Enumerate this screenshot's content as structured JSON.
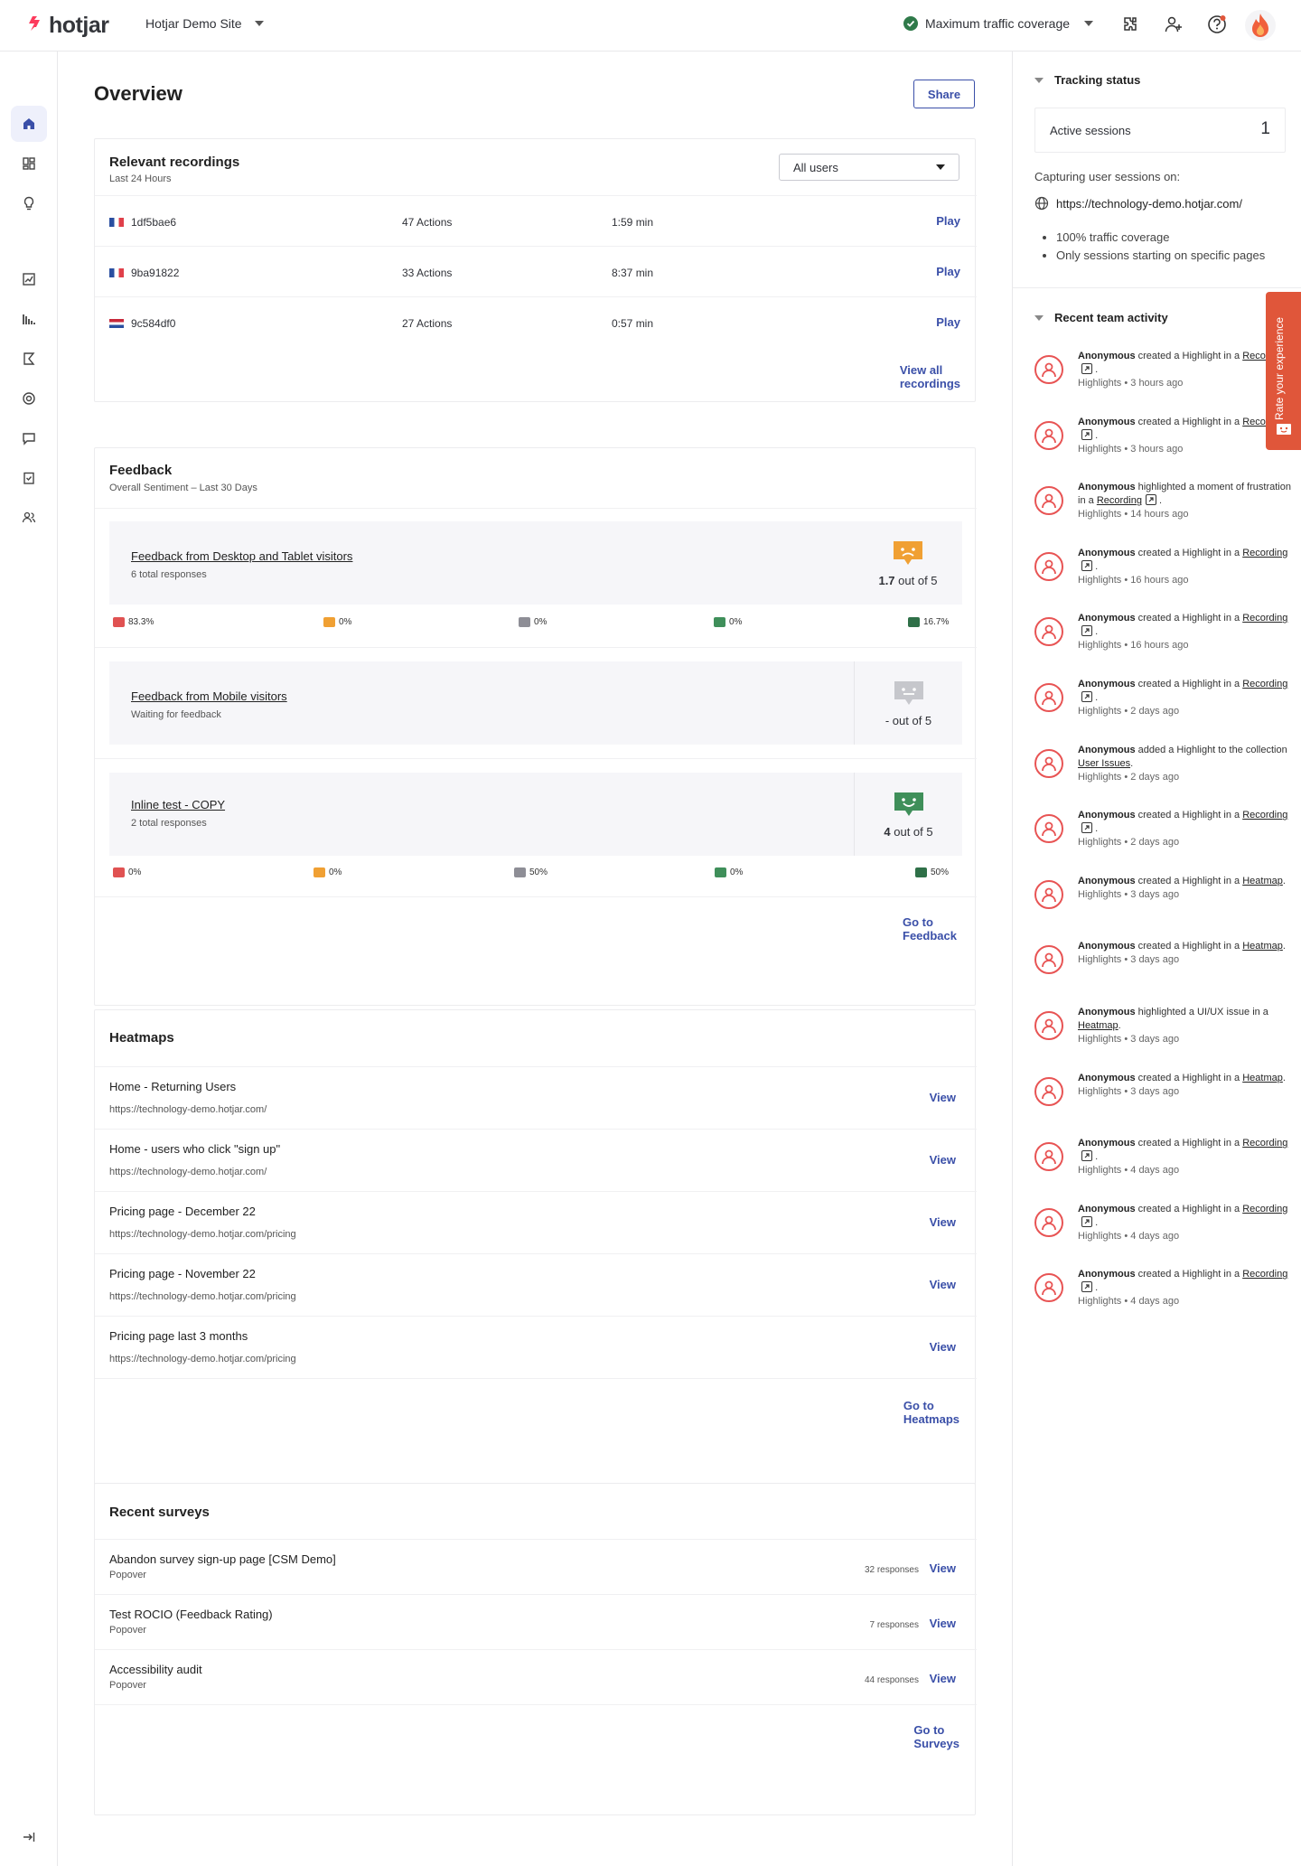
{
  "topbar": {
    "logo_text": "hotjar",
    "site_name": "Hotjar Demo Site",
    "traffic_label": "Maximum traffic coverage"
  },
  "page": {
    "title": "Overview",
    "share_label": "Share"
  },
  "recordings": {
    "title": "Relevant recordings",
    "subtitle": "Last 24 Hours",
    "filter_value": "All users",
    "rows": [
      {
        "id": "1df5bae6",
        "actions": "47 Actions",
        "duration": "1:59 min",
        "play": "Play",
        "flag": "France"
      },
      {
        "id": "9ba91822",
        "actions": "33 Actions",
        "duration": "8:37 min",
        "play": "Play",
        "flag": "France"
      },
      {
        "id": "9c584df0",
        "actions": "27 Actions",
        "duration": "0:57 min",
        "play": "Play",
        "flag": "Netherlands"
      }
    ],
    "view_all": "View all recordings"
  },
  "feedback": {
    "title": "Feedback",
    "subtitle": "Overall Sentiment – Last 30 Days",
    "widgets": [
      {
        "name": "Feedback from Desktop and Tablet visitors",
        "count": "6 total responses",
        "score": "1.7",
        "score_suffix": " out of 5",
        "sentiment": "unhappy",
        "distribution": [
          "83.3%",
          "0%",
          "0%",
          "0%",
          "16.7%"
        ]
      },
      {
        "name": "Feedback from Mobile visitors",
        "count": "Waiting for feedback",
        "score": "-",
        "score_suffix": " out of 5",
        "sentiment": "none"
      },
      {
        "name": "Inline test - COPY",
        "count": "2 total responses",
        "score": "4",
        "score_suffix": " out of 5",
        "sentiment": "happy",
        "distribution": [
          "0%",
          "0%",
          "50%",
          "0%",
          "50%"
        ]
      }
    ],
    "go_to": "Go to Feedback",
    "colors": {
      "hate": "#e05252",
      "dislike": "#f0a033",
      "neutral": "#8e8e96",
      "like": "#3f8f5a",
      "love": "#2f7048"
    }
  },
  "heatmaps": {
    "title": "Heatmaps",
    "rows": [
      {
        "name": "Home - Returning Users",
        "url": "https://technology-demo.hotjar.com/",
        "action": "View"
      },
      {
        "name": "Home - users who click \"sign up\"",
        "url": "https://technology-demo.hotjar.com/",
        "action": "View"
      },
      {
        "name": "Pricing page - December 22",
        "url": "https://technology-demo.hotjar.com/pricing",
        "action": "View"
      },
      {
        "name": "Pricing page - November 22",
        "url": "https://technology-demo.hotjar.com/pricing",
        "action": "View"
      },
      {
        "name": "Pricing page last 3 months",
        "url": "https://technology-demo.hotjar.com/pricing",
        "action": "View"
      }
    ],
    "go_to": "Go to Heatmaps"
  },
  "surveys": {
    "title": "Recent surveys",
    "rows": [
      {
        "name": "Abandon survey sign-up page [CSM Demo]",
        "type": "Popover",
        "responses": "32 responses",
        "action": "View"
      },
      {
        "name": "Test ROCIO (Feedback Rating)",
        "type": "Popover",
        "responses": "7 responses",
        "action": "View"
      },
      {
        "name": "Accessibility audit",
        "type": "Popover",
        "responses": "44 responses",
        "action": "View"
      }
    ],
    "go_to": "Go to Surveys"
  },
  "tracking": {
    "title": "Tracking status",
    "active_label": "Active sessions",
    "active_count": "1",
    "capturing_label": "Capturing user sessions on:",
    "url": "https://technology-demo.hotjar.com/",
    "bullets": [
      "100% traffic coverage",
      "Only sessions starting on specific pages"
    ]
  },
  "activity": {
    "title": "Recent team activity",
    "items": [
      {
        "actor": "Anonymous",
        "verb": " created a Highlight in a",
        "target": "Recording",
        "ext": true,
        "suffix": ".",
        "meta": "Highlights • 3 hours ago"
      },
      {
        "actor": "Anonymous",
        "verb": " created a Highlight in a",
        "target": "Recording",
        "ext": true,
        "suffix": ".",
        "meta": "Highlights • 3 hours ago"
      },
      {
        "actor": "Anonymous",
        "verb": " highlighted a moment of frustration in a",
        "target": "Recording",
        "ext": true,
        "suffix": ".",
        "meta": "Highlights • 14 hours ago"
      },
      {
        "actor": "Anonymous",
        "verb": " created a Highlight in a",
        "target": "Recording",
        "ext": true,
        "suffix": ".",
        "meta": "Highlights • 16 hours ago"
      },
      {
        "actor": "Anonymous",
        "verb": " created a Highlight in a",
        "target": "Recording",
        "ext": true,
        "suffix": ".",
        "meta": "Highlights • 16 hours ago"
      },
      {
        "actor": "Anonymous",
        "verb": " created a Highlight in a",
        "target": "Recording",
        "ext": true,
        "suffix": ".",
        "meta": "Highlights • 2 days ago"
      },
      {
        "actor": "Anonymous",
        "verb": " added a Highlight to the collection",
        "target": "User Issues",
        "ext": false,
        "suffix": ".",
        "meta": "Highlights • 2 days ago"
      },
      {
        "actor": "Anonymous",
        "verb": " created a Highlight in a",
        "target": "Recording",
        "ext": true,
        "suffix": ".",
        "meta": "Highlights • 2 days ago"
      },
      {
        "actor": "Anonymous",
        "verb": " created a Highlight in a",
        "target": "Heatmap",
        "ext": false,
        "suffix": ".",
        "meta": "Highlights • 3 days ago"
      },
      {
        "actor": "Anonymous",
        "verb": " created a Highlight in a",
        "target": "Heatmap",
        "ext": false,
        "suffix": ".",
        "meta": "Highlights • 3 days ago"
      },
      {
        "actor": "Anonymous",
        "verb": " highlighted a UI/UX issue in a",
        "target": "Heatmap",
        "ext": false,
        "suffix": ".",
        "meta": "Highlights • 3 days ago"
      },
      {
        "actor": "Anonymous",
        "verb": " created a Highlight in a",
        "target": "Heatmap",
        "ext": false,
        "suffix": ".",
        "meta": "Highlights • 3 days ago"
      },
      {
        "actor": "Anonymous",
        "verb": " created a Highlight in a",
        "target": "Recording",
        "ext": true,
        "suffix": ".",
        "meta": "Highlights • 4 days ago"
      },
      {
        "actor": "Anonymous",
        "verb": " created a Highlight in a",
        "target": "Recording",
        "ext": true,
        "suffix": ".",
        "meta": "Highlights • 4 days ago"
      },
      {
        "actor": "Anonymous",
        "verb": " created a Highlight in a",
        "target": "Recording",
        "ext": true,
        "suffix": ".",
        "meta": "Highlights • 4 days ago"
      }
    ]
  },
  "rate_tab": {
    "label": "Rate your experience"
  },
  "sidebar": {
    "items": [
      "home-icon",
      "dashboards-icon",
      "lightbulb-icon",
      "trends-icon",
      "funnels-icon",
      "recordings-icon",
      "interviews-icon",
      "feedback-icon",
      "surveys-icon",
      "users-icon"
    ],
    "collapse": "collapse-icon"
  },
  "colors": {
    "accent": "#3a4fa8",
    "brand": "#fd3a5c",
    "activity_avatar": "#e85454",
    "rate_tab": "#e0563a",
    "success": "#2f7a4a"
  }
}
